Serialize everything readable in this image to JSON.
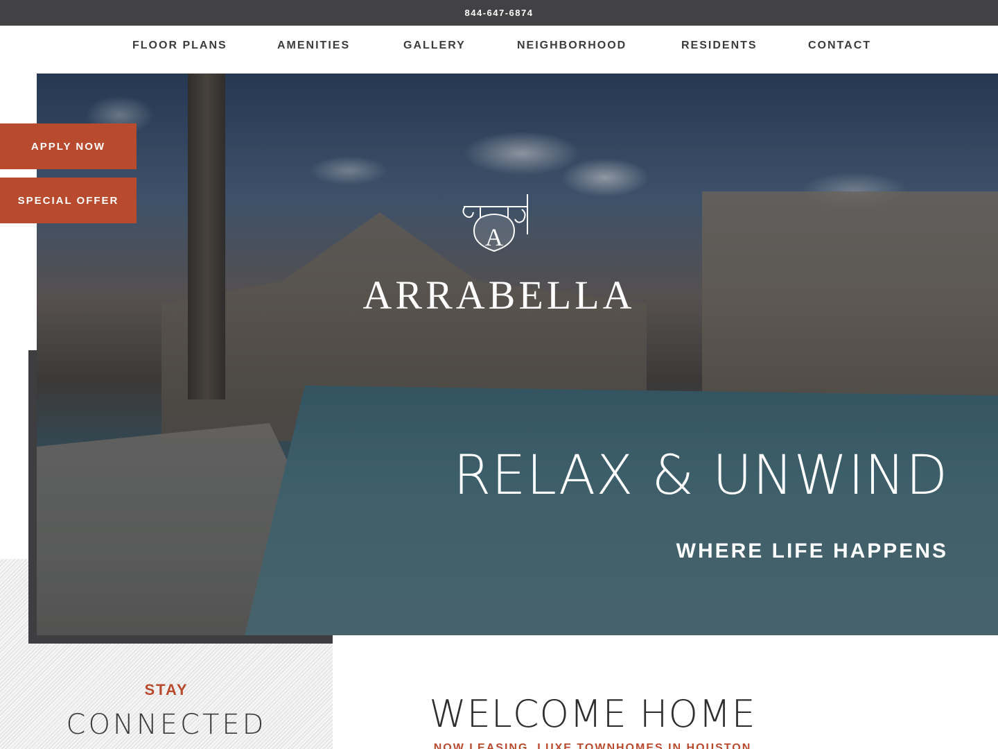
{
  "topbar": {
    "phone": "844-647-6874"
  },
  "nav": {
    "items": [
      {
        "label": "FLOOR PLANS"
      },
      {
        "label": "AMENITIES"
      },
      {
        "label": "GALLERY"
      },
      {
        "label": "NEIGHBORHOOD"
      },
      {
        "label": "RESIDENTS"
      },
      {
        "label": "CONTACT"
      }
    ]
  },
  "cta": {
    "apply": "APPLY NOW",
    "offer": "SPECIAL OFFER"
  },
  "hero": {
    "brand_name": "ARRABELLA",
    "headline": "RELAX & UNWIND",
    "tagline": "WHERE LIFE HAPPENS"
  },
  "logo": {
    "monogram": "A",
    "icon": "hanging-sign-monogram-icon"
  },
  "stay": {
    "label": "STAY",
    "title": "CONNECTED"
  },
  "welcome": {
    "title": "WELCOME HOME",
    "subtitle": "NOW LEASING, LUXE TOWNHOMES IN HOUSTON"
  },
  "colors": {
    "accent": "#b84a2e",
    "topbar": "#424244",
    "frame": "#3e3e40"
  }
}
